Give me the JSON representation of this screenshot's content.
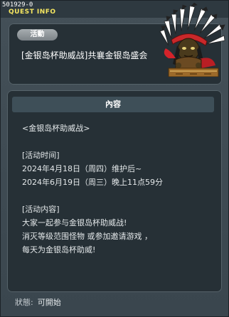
{
  "topbar": {
    "quest_id": "501929-0",
    "title": "QUEST INFO"
  },
  "header": {
    "badge": "活動",
    "text": "[金银岛杯助威战]共襄金银岛盛会"
  },
  "npc": {
    "icon": "native-chief-npc-icon"
  },
  "content": {
    "heading": "內容",
    "lines": [
      "<金银岛杯助威战>",
      "",
      "[活动时间]",
      "2024年4月18日（周四）维护后~",
      "2024年6月19日（周三）晚上11点59分",
      "",
      "[活动内容]",
      "大家一起参与金银岛杯助威战!",
      "消灭等级范围怪物 或参加邀请游戏 ，",
      "每天为金银岛杯助威!"
    ]
  },
  "status": {
    "label": "狀態:",
    "value": "可開始"
  }
}
